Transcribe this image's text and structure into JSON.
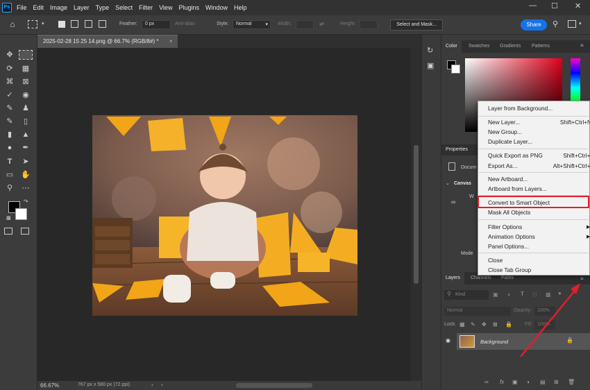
{
  "app": {
    "logo": "Ps",
    "menu": [
      "File",
      "Edit",
      "Image",
      "Layer",
      "Type",
      "Select",
      "Filter",
      "View",
      "Plugins",
      "Window",
      "Help"
    ],
    "window_controls": [
      "minimize-icon",
      "maximize-icon",
      "close-icon"
    ]
  },
  "options_bar": {
    "feather_label": "Feather:",
    "feather_value": "0 px",
    "anti_alias_label": "Anti-alias",
    "style_label": "Style:",
    "style_value": "Normal",
    "width_label": "Width:",
    "height_label": "Height:",
    "select_mask_label": "Select and Mask...",
    "share_label": "Share"
  },
  "document": {
    "tab_title": "2025-02-28 15 25 14.png @ 66.7% (RGB/8#) *",
    "zoom": "66.67%",
    "dimensions": "767 px x 580 px (72 ppi)"
  },
  "panels": {
    "color_tabs": [
      "Color",
      "Swatches",
      "Gradients",
      "Patterns"
    ],
    "properties_title": "Properties",
    "properties_doc": "Docum",
    "canvas_section": "Canvas",
    "canvas_w_label": "W",
    "mode_label": "Mode",
    "layers_tabs": [
      "Layers",
      "Channels",
      "Paths"
    ],
    "kind_label": "Kind",
    "blend_mode": "Normal",
    "opacity_label": "Opacity:",
    "opacity_value": "100%",
    "lock_label": "Lock:",
    "fill_label": "Fill:",
    "fill_value": "100%",
    "layer_name": "Background"
  },
  "context_menu": {
    "items": [
      {
        "label": "Layer from Background...",
        "shortcut": ""
      },
      {
        "label": "New Layer...",
        "shortcut": "Shift+Ctrl+N"
      },
      {
        "label": "New Group...",
        "shortcut": ""
      },
      {
        "label": "Duplicate Layer...",
        "shortcut": ""
      },
      {
        "label": "Quick Export as PNG",
        "shortcut": "Shift+Ctrl+'"
      },
      {
        "label": "Export As...",
        "shortcut": "Alt+Shift+Ctrl+'"
      },
      {
        "label": "New Artboard...",
        "shortcut": ""
      },
      {
        "label": "Artboard from Layers...",
        "shortcut": ""
      },
      {
        "label": "Convert to Smart Object",
        "shortcut": ""
      },
      {
        "label": "Mask All Objects",
        "shortcut": ""
      },
      {
        "label": "Filter Options",
        "shortcut": ""
      },
      {
        "label": "Animation Options",
        "shortcut": ""
      },
      {
        "label": "Panel Options...",
        "shortcut": ""
      },
      {
        "label": "Close",
        "shortcut": ""
      },
      {
        "label": "Close Tab Group",
        "shortcut": ""
      }
    ]
  },
  "colors": {
    "highlight": "#e0202a",
    "arrow": "#e0202a",
    "share": "#1473e6"
  }
}
